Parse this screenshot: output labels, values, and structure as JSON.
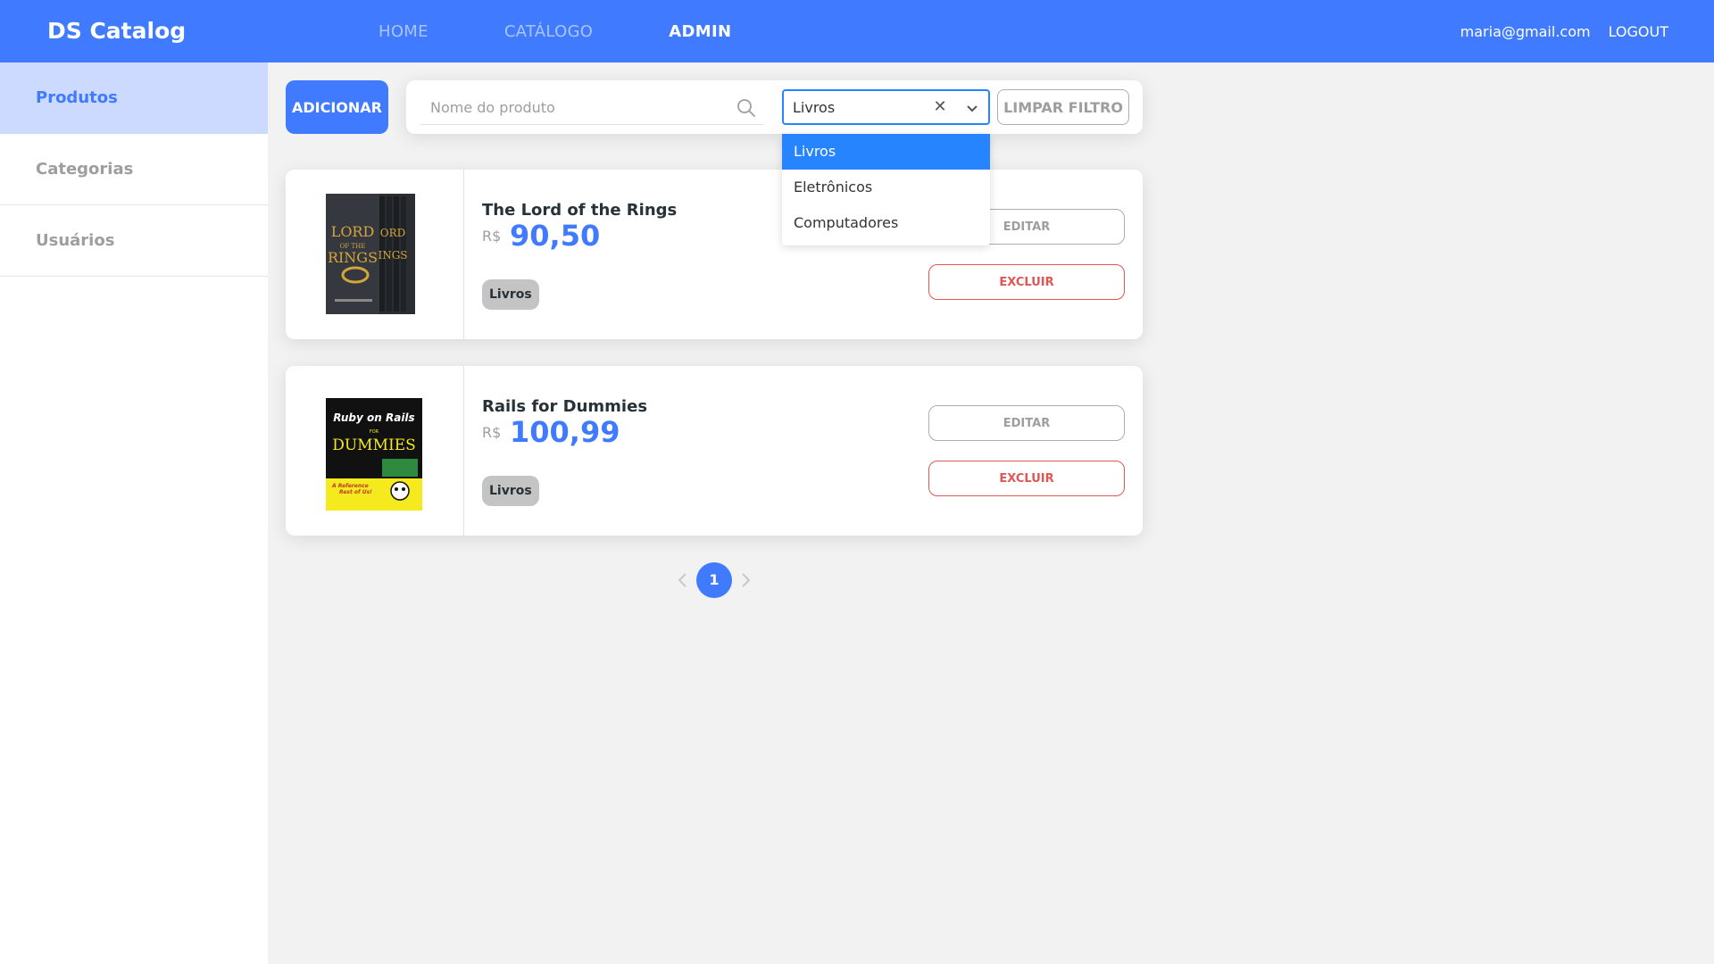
{
  "navbar": {
    "brand": "DS Catalog",
    "links": [
      {
        "label": "HOME",
        "active": false
      },
      {
        "label": "CATÁLOGO",
        "active": false
      },
      {
        "label": "ADMIN",
        "active": true
      }
    ],
    "user_email": "maria@gmail.com",
    "logout_label": "LOGOUT"
  },
  "sidebar": {
    "items": [
      {
        "label": "Produtos",
        "active": true
      },
      {
        "label": "Categorias",
        "active": false
      },
      {
        "label": "Usuários",
        "active": false
      }
    ]
  },
  "toolbar": {
    "add_label": "ADICIONAR",
    "search_placeholder": "Nome do produto",
    "category_selected": "Livros",
    "clear_filter_label": "LIMPAR FILTRO"
  },
  "dropdown": {
    "options": [
      {
        "label": "Livros",
        "selected": true
      },
      {
        "label": "Eletrônicos",
        "selected": false
      },
      {
        "label": "Computadores",
        "selected": false
      }
    ]
  },
  "products": [
    {
      "name": "The Lord of the Rings",
      "currency": "R$",
      "price": "90,50",
      "category": "Livros",
      "edit_label": "EDITAR",
      "delete_label": "EXCLUIR",
      "image_icon": "lord-of-the-rings-book-cover"
    },
    {
      "name": "Rails for Dummies",
      "currency": "R$",
      "price": "100,99",
      "category": "Livros",
      "edit_label": "EDITAR",
      "delete_label": "EXCLUIR",
      "image_icon": "rails-for-dummies-book-cover"
    }
  ],
  "pagination": {
    "current_page": "1"
  },
  "colors": {
    "primary": "#407bff",
    "danger": "#df5753",
    "select_focus": "#2684ff"
  }
}
